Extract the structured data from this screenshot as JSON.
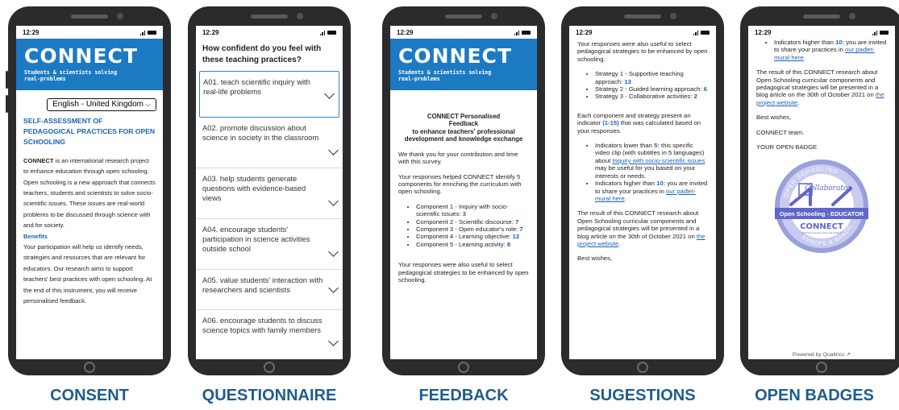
{
  "status_time": "12:29",
  "labels": {
    "consent": "CONSENT",
    "questionnaire": "QUESTIONNAIRE",
    "feedback": "FEEDBACK",
    "suggestions": "SUGESTIONS",
    "open_badges": "OPEN BADGES"
  },
  "brand": {
    "logo": "CONNECT",
    "tagline_1": "Students & scientists solving",
    "tagline_2": "real-problems"
  },
  "consent": {
    "language_select": "English - United Kingdom",
    "heading": "SELF-ASSESSMENT OF PEDAGOGICAL PRACTICES FOR OPEN SCHOOLING",
    "intro_bold": "CONNECT",
    "intro_rest": " is an international research project to enhance education through open schooling.",
    "p2": "Open schooling is a new approach that connects teachers, students and scientists to solve socio-scientific issues. These issues are real-world problems to be discussed through science with and for society.",
    "benefits_label": "Benefits",
    "p3": "Your participation will help us identify needs, strategies and resources that are relevant for educators. Our research aims to support teachers' best practices with open schooling. At the end of this instrument, you will receive personalised feedback."
  },
  "questionnaire": {
    "title": "How confident do you feel with these teaching practices?",
    "items": [
      "A01. teach scientific inquiry with real-life problems",
      "A02. promote discussion about science in society in the classroom",
      "A03. help students generate questions with evidence-based views",
      "A04. encourage students' participation in science activities outside school",
      "A05. value students' interaction with researchers and scientists",
      "A06. encourage students to discuss science topics with family members"
    ]
  },
  "feedback": {
    "title_1": "CONNECT Personalised",
    "title_2": "Feedback",
    "title_3": "to enhance teachers' professional development and knowledge exchange",
    "p1": "We thank you for your contribution and time with this survey.",
    "p2": "Your responses helped CONNECT identify 5 components for enriching the curriculum with open schooling.",
    "components": [
      {
        "text": "Component 1 - Inquiry with socio-scientific issues: ",
        "score": "3"
      },
      {
        "text": "Component 2 - Scientific discourse: ",
        "score": "7"
      },
      {
        "text": "Component 3 - Open educator's role: ",
        "score": "7"
      },
      {
        "text": "Component 4 - Learning objective: ",
        "score": "12"
      },
      {
        "text": "Component 5 - Learning activity: ",
        "score": "8"
      }
    ],
    "p3": "Your responses were also useful to select pedagogical strategies to be enhanced by open schooling."
  },
  "suggestions": {
    "p1": "Your responses were also useful to select pedagogical strategies to be enhanced by open schooling.",
    "strategies": [
      {
        "text": "Strategy 1 - Supportive teaching approach: ",
        "score": "13"
      },
      {
        "text": "Strategy 2 - Guided learning approach: ",
        "score": "6"
      },
      {
        "text": "Strategy 3 - Collaborative activities: ",
        "score": "2"
      }
    ],
    "p2_a": "Each component and strategy present an indicator ",
    "p2_range": "(1-15)",
    "p2_b": " that was calculated based on your responses.",
    "lower_a": "Indicators lower than ",
    "lower_num": "5:",
    "lower_b": " this specific video clip (with subtitles in 5 languages) about ",
    "lower_link": "Inquiry with socio-scientific issues",
    "lower_c": " may be useful for you based on your interests or needs.",
    "higher_a": "Indicators higher than ",
    "higher_num": "10:",
    "higher_b": " you are invited to share your practices in ",
    "higher_link": "our padlet-mural here",
    "higher_c": ".",
    "p3_a": "The result of this CONNECT research about Open Schooling curricular components and pedagogical strategies will be presented in a blog article on the 30th of October 2021 on ",
    "p3_link": "the project website",
    "p3_c": ".",
    "closing": "Best wishes,"
  },
  "open_badges": {
    "higher_a": "Indicators higher than ",
    "higher_num": "10:",
    "higher_b": " you are invited to share your practices in ",
    "higher_link": "our padlet-mural here",
    "higher_c": ".",
    "p1_a": "The result of this CONNECT research about Open Schooling curricular components and pedagogical strategies will be presented in a blog article on the 30th of October 2021 on ",
    "p1_link": "the project website",
    "p1_c": ".",
    "closing": "Best wishes,",
    "team": "CONNECT team.",
    "badge_heading": "YOUR OPEN BADGE",
    "badge_ribbon": "Open Schooling - EDUCATOR",
    "badge_logo": "CONNECT",
    "badge_tag": "Students & scientists solving real-problems",
    "badge_script": "Collaborator",
    "badge_arc_top": "OPEN SCHOOLING",
    "badge_arc_bottom": "EUROPE & BRAZIL",
    "powered": "Powered by Qualtrics"
  },
  "colors": {
    "brand_blue": "#1c7ac2",
    "label_blue": "#1f5c8f",
    "link_blue": "#1a63b5",
    "badge_purple": "#5f67c8",
    "badge_light": "#9aa0dc"
  }
}
